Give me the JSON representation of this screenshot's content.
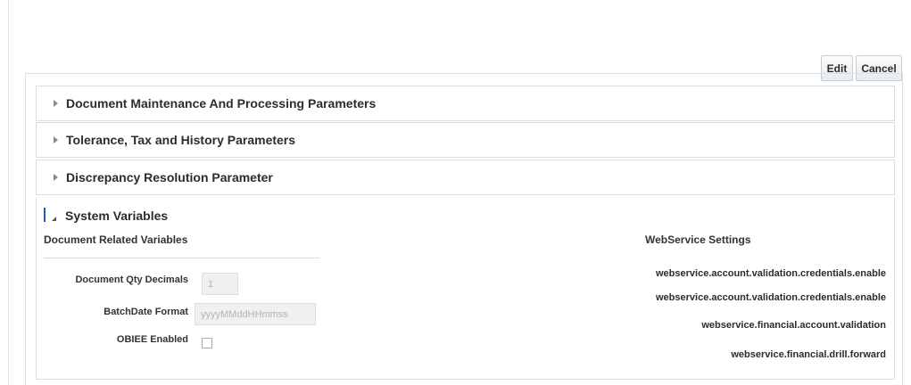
{
  "toolbar": {
    "edit_label": "Edit",
    "cancel_label": "Cancel"
  },
  "sections": [
    {
      "title": "Document Maintenance And Processing Parameters"
    },
    {
      "title": "Tolerance, Tax and History Parameters"
    },
    {
      "title": "Discrepancy Resolution Parameter"
    }
  ],
  "system_variables": {
    "title": "System Variables",
    "document_group": {
      "heading": "Document Related Variables",
      "fields": [
        {
          "label": "Document Qty Decimals",
          "value": "1"
        },
        {
          "label": "BatchDate Format",
          "value": "yyyyMMddHHmmss"
        },
        {
          "label": "OBIEE Enabled",
          "checked": false
        }
      ]
    },
    "webservice_group": {
      "heading": "WebService Settings",
      "items": [
        "webservice.account.validation.credentials.enable",
        "webservice.account.validation.credentials.enable",
        "webservice.financial.account.validation",
        "webservice.financial.drill.forward"
      ]
    }
  }
}
